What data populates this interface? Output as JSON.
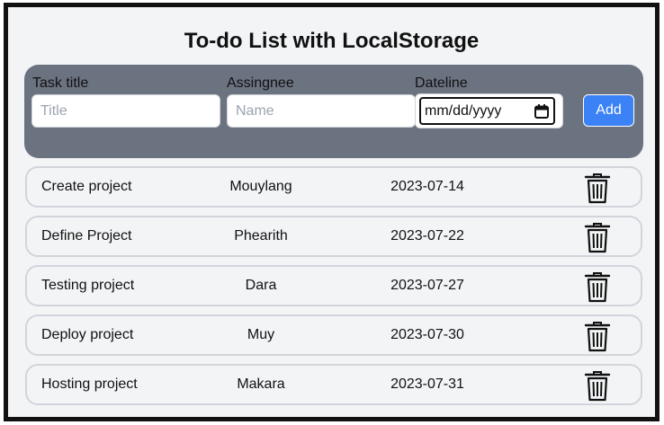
{
  "header": {
    "title": "To-do List with LocalStorage"
  },
  "form": {
    "title_label": "Task title",
    "title_placeholder": "Title",
    "assignee_label": "Assingnee",
    "assignee_placeholder": "Name",
    "date_label": "Dateline",
    "date_placeholder": "mm/dd/yyyy",
    "add_label": "Add",
    "calendar_icon": "calendar-icon"
  },
  "colors": {
    "panel": "#6b7280",
    "accent": "#3b82f6",
    "background": "#f3f4f6"
  },
  "tasks": [
    {
      "title": "Create project",
      "assignee": "Mouylang",
      "date": "2023-07-14",
      "icon": "trash-icon"
    },
    {
      "title": "Define Project",
      "assignee": "Phearith",
      "date": "2023-07-22",
      "icon": "trash-icon"
    },
    {
      "title": "Testing project",
      "assignee": "Dara",
      "date": "2023-07-27",
      "icon": "trash-icon"
    },
    {
      "title": "Deploy project",
      "assignee": "Muy",
      "date": "2023-07-30",
      "icon": "trash-icon"
    },
    {
      "title": "Hosting project",
      "assignee": "Makara",
      "date": "2023-07-31",
      "icon": "trash-icon"
    }
  ]
}
